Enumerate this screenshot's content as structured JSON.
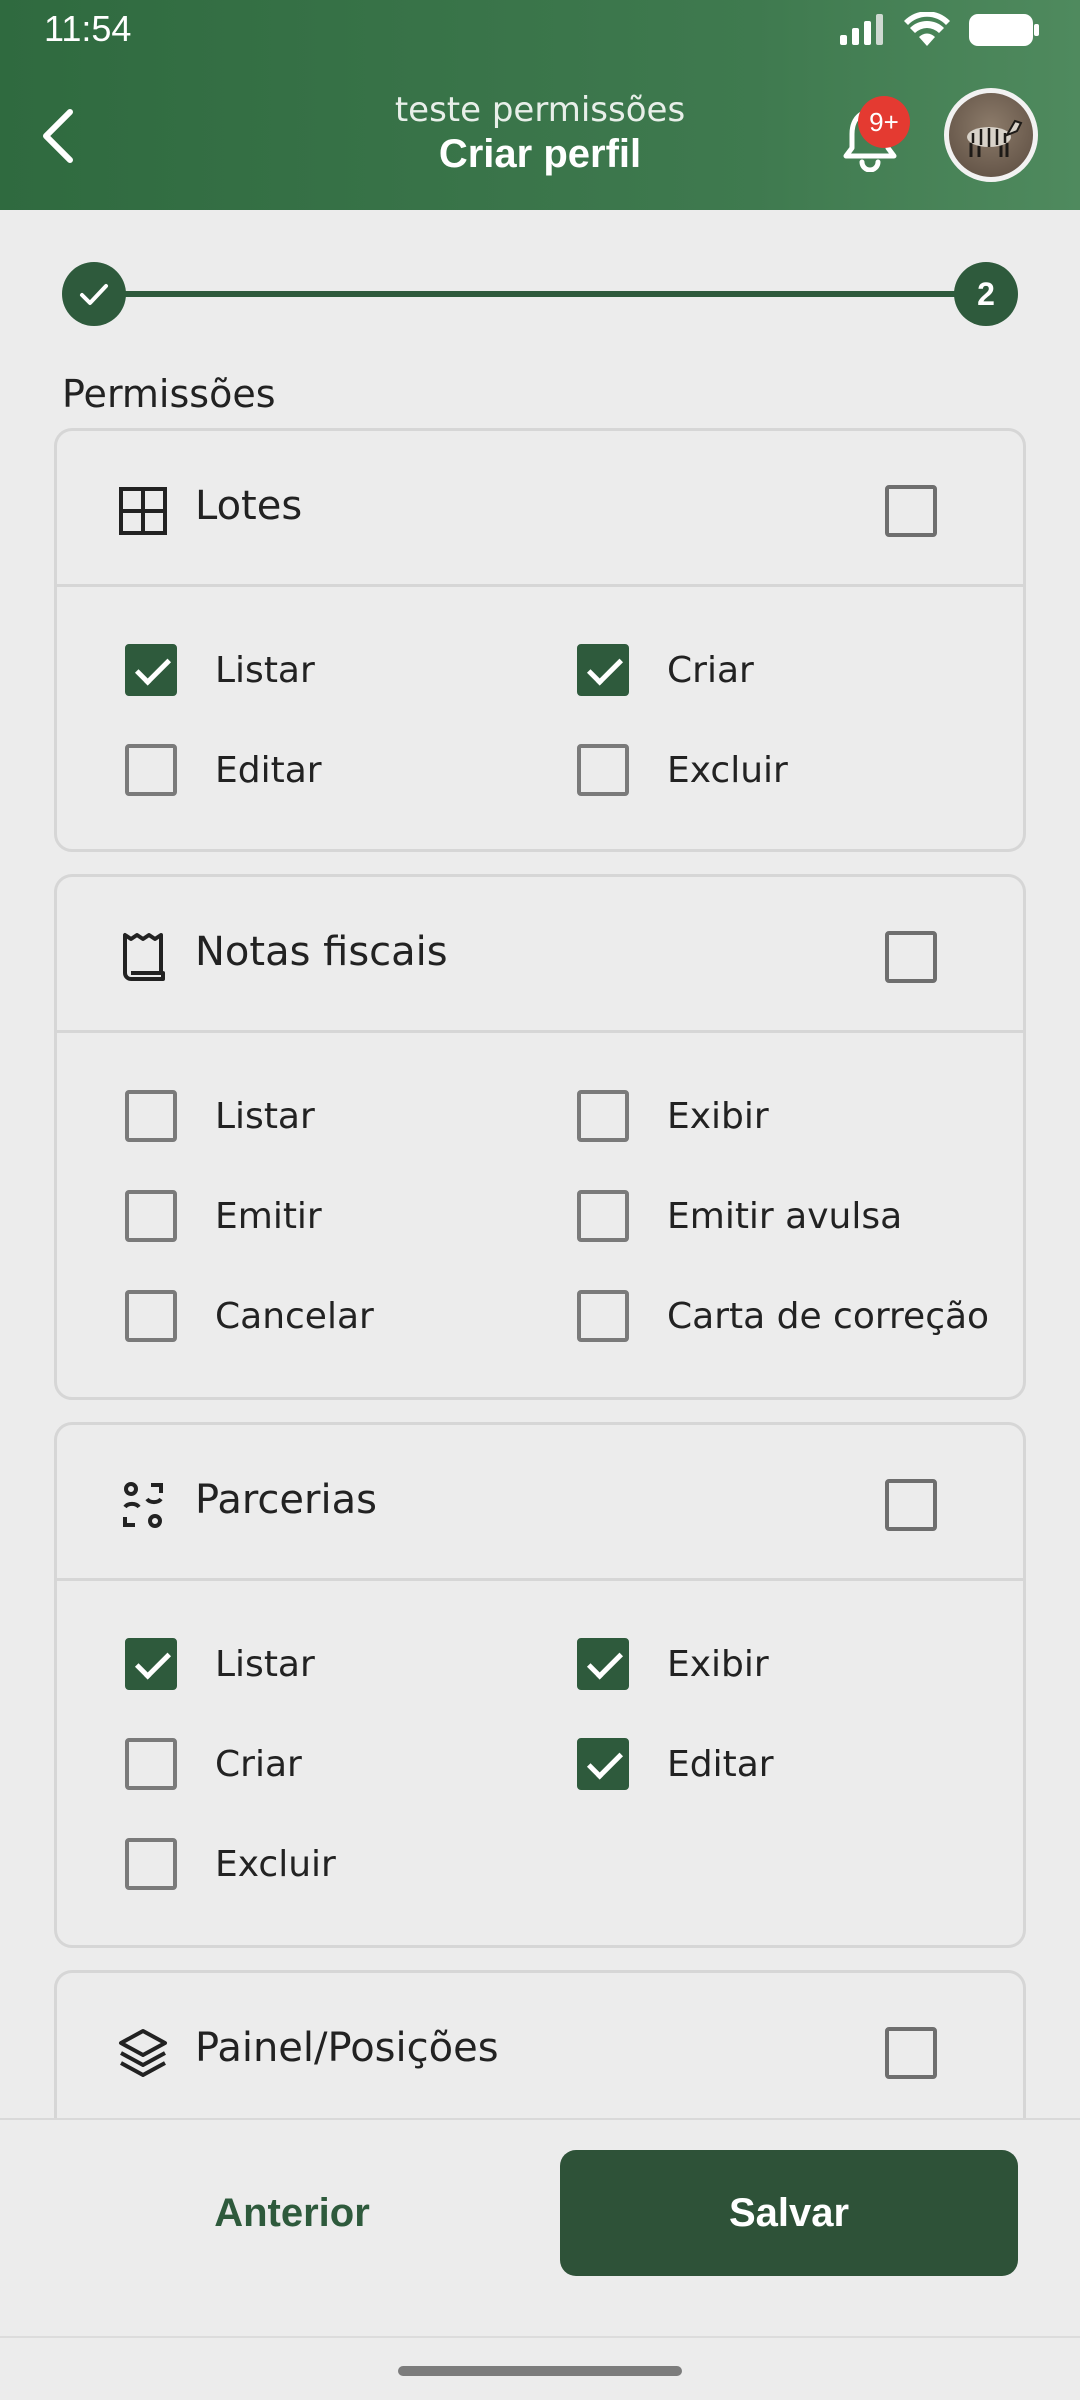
{
  "status_bar": {
    "time": "11:54"
  },
  "header": {
    "subtitle": "teste permissões",
    "title": "Criar perfil",
    "notification_badge": "9+"
  },
  "stepper": {
    "current_step": "2"
  },
  "section_title": "Permissões",
  "cards": [
    {
      "label": "Lotes",
      "icon": "grid-icon",
      "permissions": [
        {
          "label": "Listar",
          "checked": true
        },
        {
          "label": "Criar",
          "checked": true
        },
        {
          "label": "Editar",
          "checked": false
        },
        {
          "label": "Excluir",
          "checked": false
        }
      ]
    },
    {
      "label": "Notas fiscais",
      "icon": "receipt-icon",
      "permissions": [
        {
          "label": "Listar",
          "checked": false
        },
        {
          "label": "Exibir",
          "checked": false
        },
        {
          "label": "Emitir",
          "checked": false
        },
        {
          "label": "Emitir avulsa",
          "checked": false
        },
        {
          "label": "Cancelar",
          "checked": false
        },
        {
          "label": "Carta de correção",
          "checked": false
        }
      ]
    },
    {
      "label": "Parcerias",
      "icon": "partners-icon",
      "permissions": [
        {
          "label": "Listar",
          "checked": true
        },
        {
          "label": "Exibir",
          "checked": true
        },
        {
          "label": "Criar",
          "checked": false
        },
        {
          "label": "Editar",
          "checked": true
        },
        {
          "label": "Excluir",
          "checked": false
        }
      ]
    },
    {
      "label": "Painel/Posições",
      "icon": "layers-icon",
      "permissions": []
    }
  ],
  "actions": {
    "previous": "Anterior",
    "save": "Salvar"
  },
  "colors": {
    "primary": "#2e5a3c",
    "header": "#3f7a4f",
    "badge": "#e43a31"
  }
}
